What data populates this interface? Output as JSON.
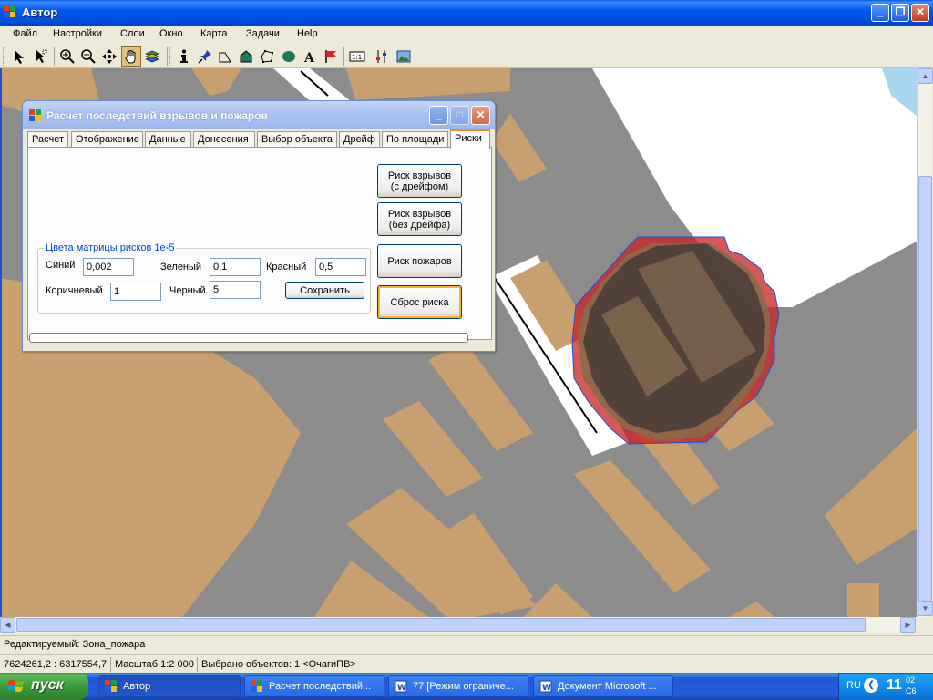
{
  "window": {
    "title": "Автор"
  },
  "menu": [
    "Файл",
    "Настройки",
    "Слои",
    "Окно",
    "Карта",
    "Задачи",
    "Help"
  ],
  "toolbar": {
    "tools": [
      "select-arrow-icon",
      "select-pointer-icon",
      "zoom-in-icon",
      "zoom-out-icon",
      "pan-move-icon",
      "hand-icon",
      "layers-icon",
      "info-icon",
      "pin-icon",
      "polyline-icon",
      "polygon-icon",
      "poly-icon",
      "ellipse-icon",
      "text-icon",
      "flag-icon",
      "scale-icon",
      "properties-icon",
      "image-icon"
    ],
    "active_tool": "hand-icon"
  },
  "dialog": {
    "title": "Расчет последствий взрывов и пожаров",
    "tabs": [
      "Расчет",
      "Отображение",
      "Данные",
      "Донесения",
      "Выбор объекта",
      "Дрейф",
      "По площади",
      "Риски"
    ],
    "active_tab": "Риски",
    "buttons": {
      "risk_explosion_drift_line1": "Риск взрывов",
      "risk_explosion_drift_line2": "(с дрейфом)",
      "risk_explosion_nodrift_line1": "Риск взрывов",
      "risk_explosion_nodrift_line2": "(без дрейфа)",
      "risk_fire": "Риск пожаров",
      "reset_risk": "Сброс риска",
      "save": "Сохранить"
    },
    "groupbox": {
      "title": "Цвета матрицы рисков 1е-5",
      "fields": {
        "blue": {
          "label": "Синий",
          "value": "0,002"
        },
        "green": {
          "label": "Зеленый",
          "value": "0,1"
        },
        "red": {
          "label": "Красный",
          "value": "0,5"
        },
        "brown": {
          "label": "Коричневый",
          "value": "1"
        },
        "black": {
          "label": "Черный",
          "value": "5"
        }
      }
    },
    "progress": 0
  },
  "status": {
    "editing": "Редактируемый: Зона_пожара",
    "coords": "7624261,2 : 6317554,7",
    "scale": "Масштаб 1:2 000",
    "selected": "Выбрано объектов: 1 <ОчагиПВ>"
  },
  "taskbar": {
    "start": "пуск",
    "tasks": [
      "Автор",
      "Расчет последствий...",
      "77 [Режим ограниче...",
      "Документ Microsoft ..."
    ],
    "lang": "RU",
    "time_hour": "11",
    "time_min_top": "02",
    "time_min_bottom": "С6"
  },
  "colors": {
    "map_bg": "#8c8c8c",
    "building": "#c8a070",
    "white_area": "#ffffff",
    "water": "#a8d8f0",
    "risk_red": "#c82020",
    "risk_black": "#303030"
  }
}
